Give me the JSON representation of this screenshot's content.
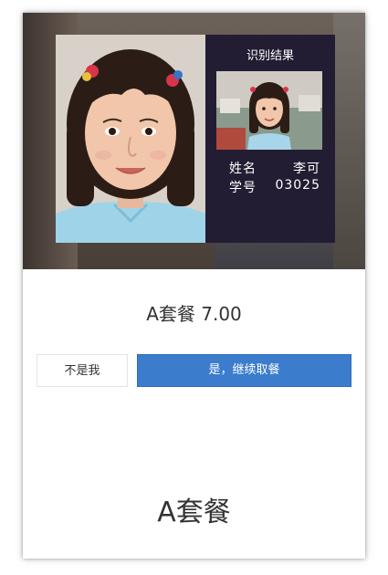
{
  "recognition": {
    "title": "识别结果",
    "name_label": "姓名",
    "name_value": "李可",
    "id_label": "学号",
    "id_value": "03025"
  },
  "order": {
    "price_line": "A套餐 7.00",
    "meal_name": "A套餐"
  },
  "actions": {
    "not_me_label": "不是我",
    "confirm_label": "是，继续取餐"
  },
  "colors": {
    "accent": "#3b7ccc",
    "panel": "#231d33"
  }
}
